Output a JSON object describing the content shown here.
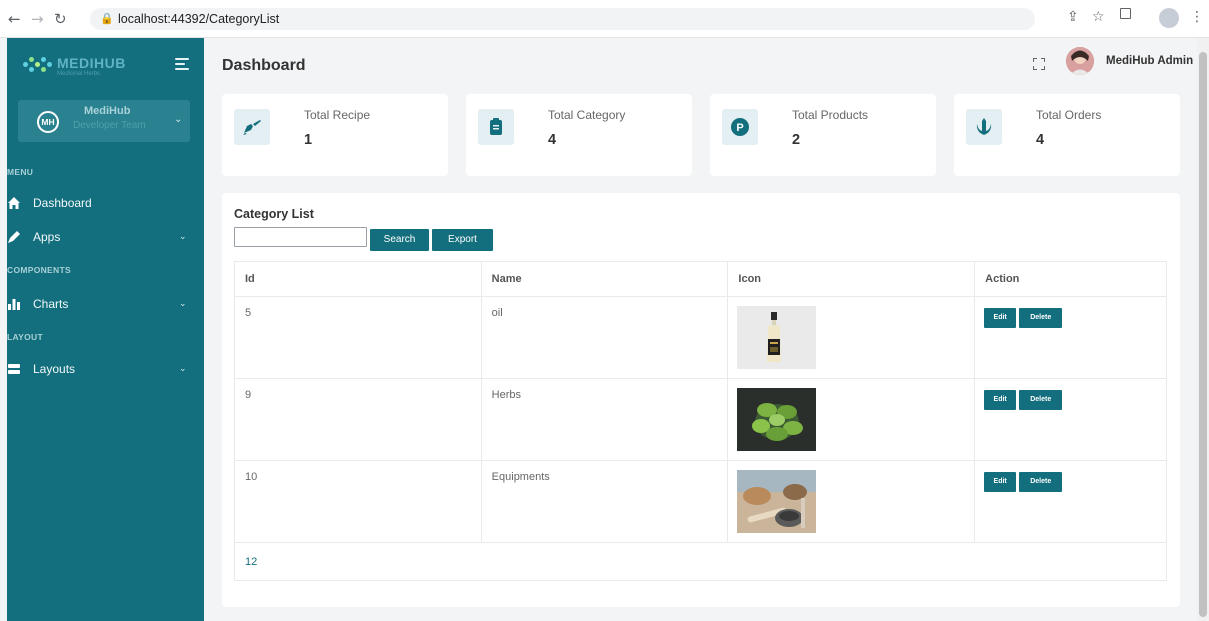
{
  "browser": {
    "url": "localhost:44392/CategoryList",
    "back_icon": "arrow-left-icon",
    "forward_icon": "arrow-right-icon",
    "reload_icon": "reload-icon"
  },
  "sidebar": {
    "brand": "MEDIHUB",
    "brand_sub": "Medicinal Herbs",
    "team": {
      "initials": "MH",
      "name": "MediHub",
      "subtitle": "Developer Team"
    },
    "sections": {
      "menu": "MENU",
      "components": "COMPONENTS",
      "layout": "LAYOUT"
    },
    "items": [
      {
        "label": "Dashboard",
        "icon": "home-icon"
      },
      {
        "label": "Apps",
        "icon": "pen-icon"
      },
      {
        "label": "Charts",
        "icon": "bar-chart-icon"
      },
      {
        "label": "Layouts",
        "icon": "layout-icon"
      }
    ]
  },
  "header": {
    "title": "Dashboard",
    "user_name": "MediHub Admin"
  },
  "stats": [
    {
      "label": "Total Recipe",
      "value": "1",
      "icon": "mortar-pestle-icon"
    },
    {
      "label": "Total Category",
      "value": "4",
      "icon": "clipboard-icon"
    },
    {
      "label": "Total Products",
      "value": "2",
      "icon": "product-p-icon"
    },
    {
      "label": "Total Orders",
      "value": "4",
      "icon": "jedi-order-icon"
    }
  ],
  "category": {
    "title": "Category List",
    "search_value": "",
    "search_label": "Search",
    "export_label": "Export",
    "columns": [
      "Id",
      "Name",
      "Icon",
      "Action"
    ],
    "rows": [
      {
        "id": "5",
        "name": "oil",
        "image": "oil-bottle-image"
      },
      {
        "id": "9",
        "name": "Herbs",
        "image": "herbs-plant-image"
      },
      {
        "id": "10",
        "name": "Equipments",
        "image": "mortar-tools-image"
      }
    ],
    "edit_label": "Edit",
    "delete_label": "Delete",
    "pager": "12"
  },
  "colors": {
    "accent": "#136e7d",
    "sidebar": "#136e7d",
    "background": "#f3f4f6"
  }
}
